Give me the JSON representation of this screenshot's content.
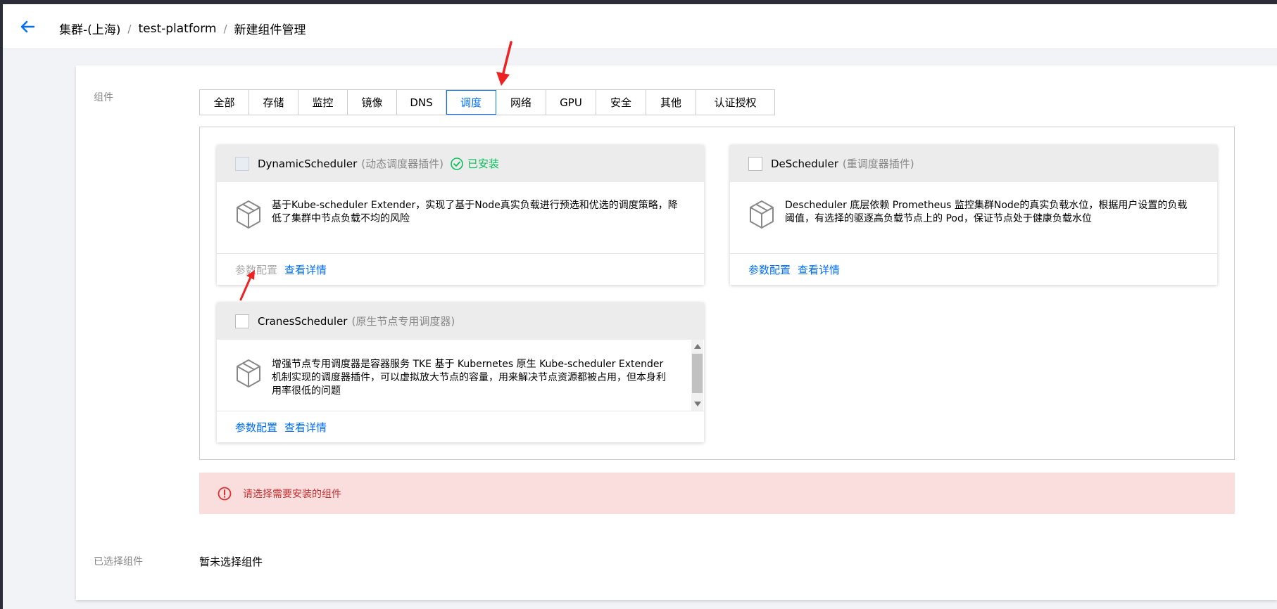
{
  "header": {
    "back_icon": "arrow-left-icon",
    "breadcrumb": [
      "集群-(上海)",
      "test-platform",
      "新建组件管理"
    ],
    "separator": "/"
  },
  "form": {
    "component_label": "组件",
    "selected_label": "已选择组件",
    "selected_value": "暂未选择组件"
  },
  "tabs": [
    {
      "label": "全部",
      "active": false
    },
    {
      "label": "存储",
      "active": false
    },
    {
      "label": "监控",
      "active": false
    },
    {
      "label": "镜像",
      "active": false
    },
    {
      "label": "DNS",
      "active": false
    },
    {
      "label": "调度",
      "active": true
    },
    {
      "label": "网络",
      "active": false
    },
    {
      "label": "GPU",
      "active": false
    },
    {
      "label": "安全",
      "active": false
    },
    {
      "label": "其他",
      "active": false
    },
    {
      "label": "认证授权",
      "active": false
    }
  ],
  "cards": [
    {
      "name": "DynamicScheduler",
      "sub": "(动态调度器插件)",
      "installed_label": "已安装",
      "desc": "基于Kube-scheduler Extender，实现了基于Node真实负载进行预选和优选的调度策略，降低了集群中节点负载不均的风险",
      "config_label": "参数配置",
      "detail_label": "查看详情"
    },
    {
      "name": "DeScheduler",
      "sub": "(重调度器插件)",
      "desc": "Descheduler 底层依赖 Prometheus 监控集群Node的真实负载水位，根据用户设置的负载阈值，有选择的驱逐高负载节点上的 Pod，保证节点处于健康负载水位",
      "config_label": "参数配置",
      "detail_label": "查看详情"
    },
    {
      "name": "CranesScheduler",
      "sub": "(原生节点专用调度器)",
      "desc": "增强节点专用调度器是容器服务 TKE 基于 Kubernetes 原生 Kube-scheduler Extender 机制实现的调度器插件，可以虚拟放大节点的容量，用来解决节点资源都被占用，但本身利用率很低的问题",
      "config_label": "参数配置",
      "detail_label": "查看详情"
    }
  ],
  "alert": {
    "icon": "error-circle-icon",
    "message": "请选择需要安装的组件"
  },
  "colors": {
    "accent": "#006eff",
    "success": "#0abf5b",
    "error": "#c43131",
    "error_bg": "#fadddd",
    "annotation_arrow": "#ee2222"
  }
}
